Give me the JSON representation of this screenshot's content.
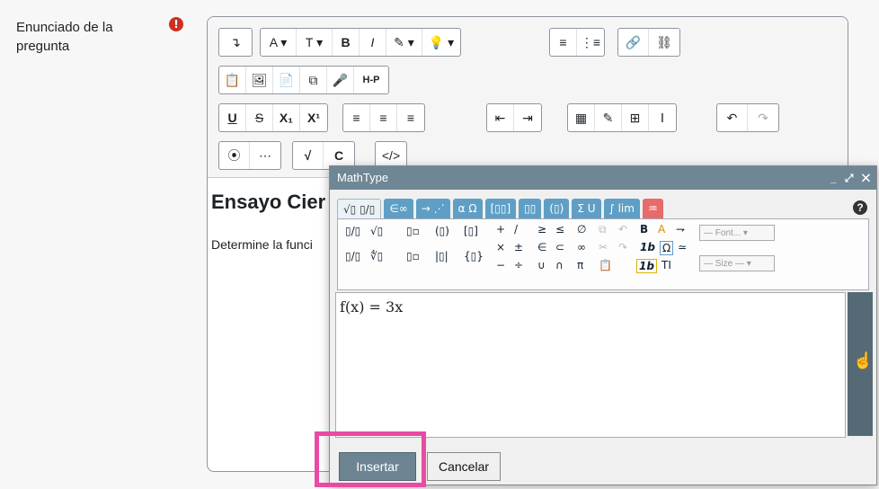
{
  "question": {
    "label": "Enunciado de la pregunta",
    "required_badge": "!",
    "content_title": "Ensayo Cier",
    "content_text": "Determine la funci"
  },
  "toolbar": {
    "row1": [
      "↴",
      "A ▾",
      "T ▾",
      "B",
      "I",
      "✎ ▾",
      "💡 ▾",
      "≡",
      "⋮≡",
      "🔗",
      "⛓"
    ],
    "row2": [
      "📋",
      "🖼",
      "📄",
      "⧉",
      "🎤",
      "H-P"
    ],
    "row3": [
      "U",
      "S",
      "X₁",
      "X¹",
      "≡",
      "≡",
      "≡",
      "⇤",
      "⇥",
      "▦",
      "✎",
      "⊞",
      "Ⅰ",
      "↶",
      "↷"
    ],
    "row4": [
      "⦿",
      "⋯",
      "√",
      "C",
      "</>"
    ]
  },
  "mathtype": {
    "title": "MathType",
    "tabs": [
      "√▯ ▯/▯",
      "∈∞",
      "→ ⋰",
      "α Ω",
      "[▯▯]",
      "▯▯",
      "(▯)",
      "Σ U",
      "∫ lim",
      "♒"
    ],
    "help": "?",
    "font_select": "— Font... ▾",
    "size_select": "— Size — ▾",
    "formula": "f(x) = 3x",
    "insert_label": "Insertar",
    "cancel_label": "Cancelar"
  }
}
